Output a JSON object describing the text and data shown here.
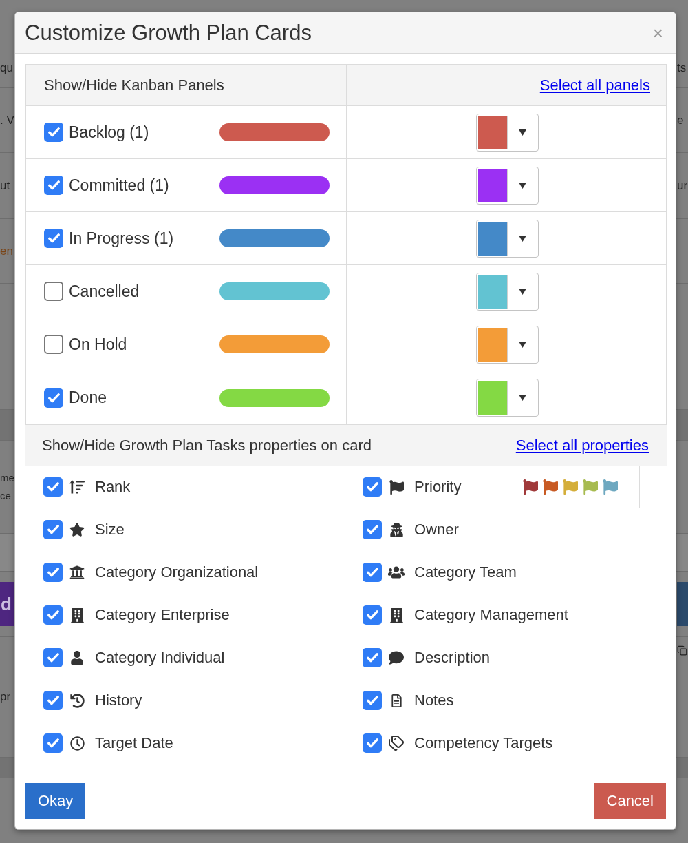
{
  "backdrop": {
    "rows": [
      {
        "kind": "text",
        "left": "qu",
        "right": "ts"
      },
      {
        "kind": "text",
        "left": ". V",
        "right": "e"
      },
      {
        "kind": "text",
        "left": "ut",
        "right": "ur"
      },
      {
        "kind": "link",
        "left": "en"
      },
      {
        "kind": "blank"
      },
      {
        "kind": "blank"
      },
      {
        "kind": "band"
      },
      {
        "kind": "wrapped",
        "lines": [
          "me",
          "ce"
        ]
      },
      {
        "kind": "light_band"
      },
      {
        "kind": "banner",
        "left": "d"
      },
      {
        "kind": "tools",
        "left": "pr"
      },
      {
        "kind": "band"
      }
    ]
  },
  "dialog": {
    "title": "Customize Growth Plan Cards",
    "close": "×"
  },
  "panels_section": {
    "heading": "Show/Hide Kanban Panels",
    "select_all": "Select all panels"
  },
  "panels": [
    {
      "label": "Backlog (1)",
      "checked": true,
      "color": "#cd5a4f"
    },
    {
      "label": "Committed (1)",
      "checked": true,
      "color": "#9b30f3"
    },
    {
      "label": "In Progress (1)",
      "checked": true,
      "color": "#4489c8"
    },
    {
      "label": "Cancelled",
      "checked": false,
      "color": "#62c3d2"
    },
    {
      "label": "On Hold",
      "checked": false,
      "color": "#f39c38"
    },
    {
      "label": "Done",
      "checked": true,
      "color": "#84d944"
    }
  ],
  "properties_section": {
    "heading": "Show/Hide Growth Plan Tasks properties on card",
    "select_all": "Select all properties"
  },
  "properties": [
    {
      "label": "Rank",
      "checked": true
    },
    {
      "label": "Priority",
      "checked": true,
      "flags": [
        {
          "color": "#a0393a"
        },
        {
          "color": "#c85a23"
        },
        {
          "color": "#d4ae3a"
        },
        {
          "color": "#a7bb50"
        },
        {
          "color": "#6ea8c0"
        }
      ]
    },
    {
      "label": "Size",
      "checked": true
    },
    {
      "label": "Owner",
      "checked": true
    },
    {
      "label": "Category Organizational",
      "checked": true
    },
    {
      "label": "Category Team",
      "checked": true
    },
    {
      "label": "Category Enterprise",
      "checked": true
    },
    {
      "label": "Category Management",
      "checked": true
    },
    {
      "label": "Category Individual",
      "checked": true
    },
    {
      "label": "Description",
      "checked": true
    },
    {
      "label": "History",
      "checked": true
    },
    {
      "label": "Notes",
      "checked": true
    },
    {
      "label": "Target Date",
      "checked": true
    },
    {
      "label": "Competency Targets",
      "checked": true
    }
  ],
  "buttons": [
    {
      "label": "Okay",
      "kind": "primary"
    },
    {
      "label": "Cancel",
      "kind": "danger"
    }
  ]
}
